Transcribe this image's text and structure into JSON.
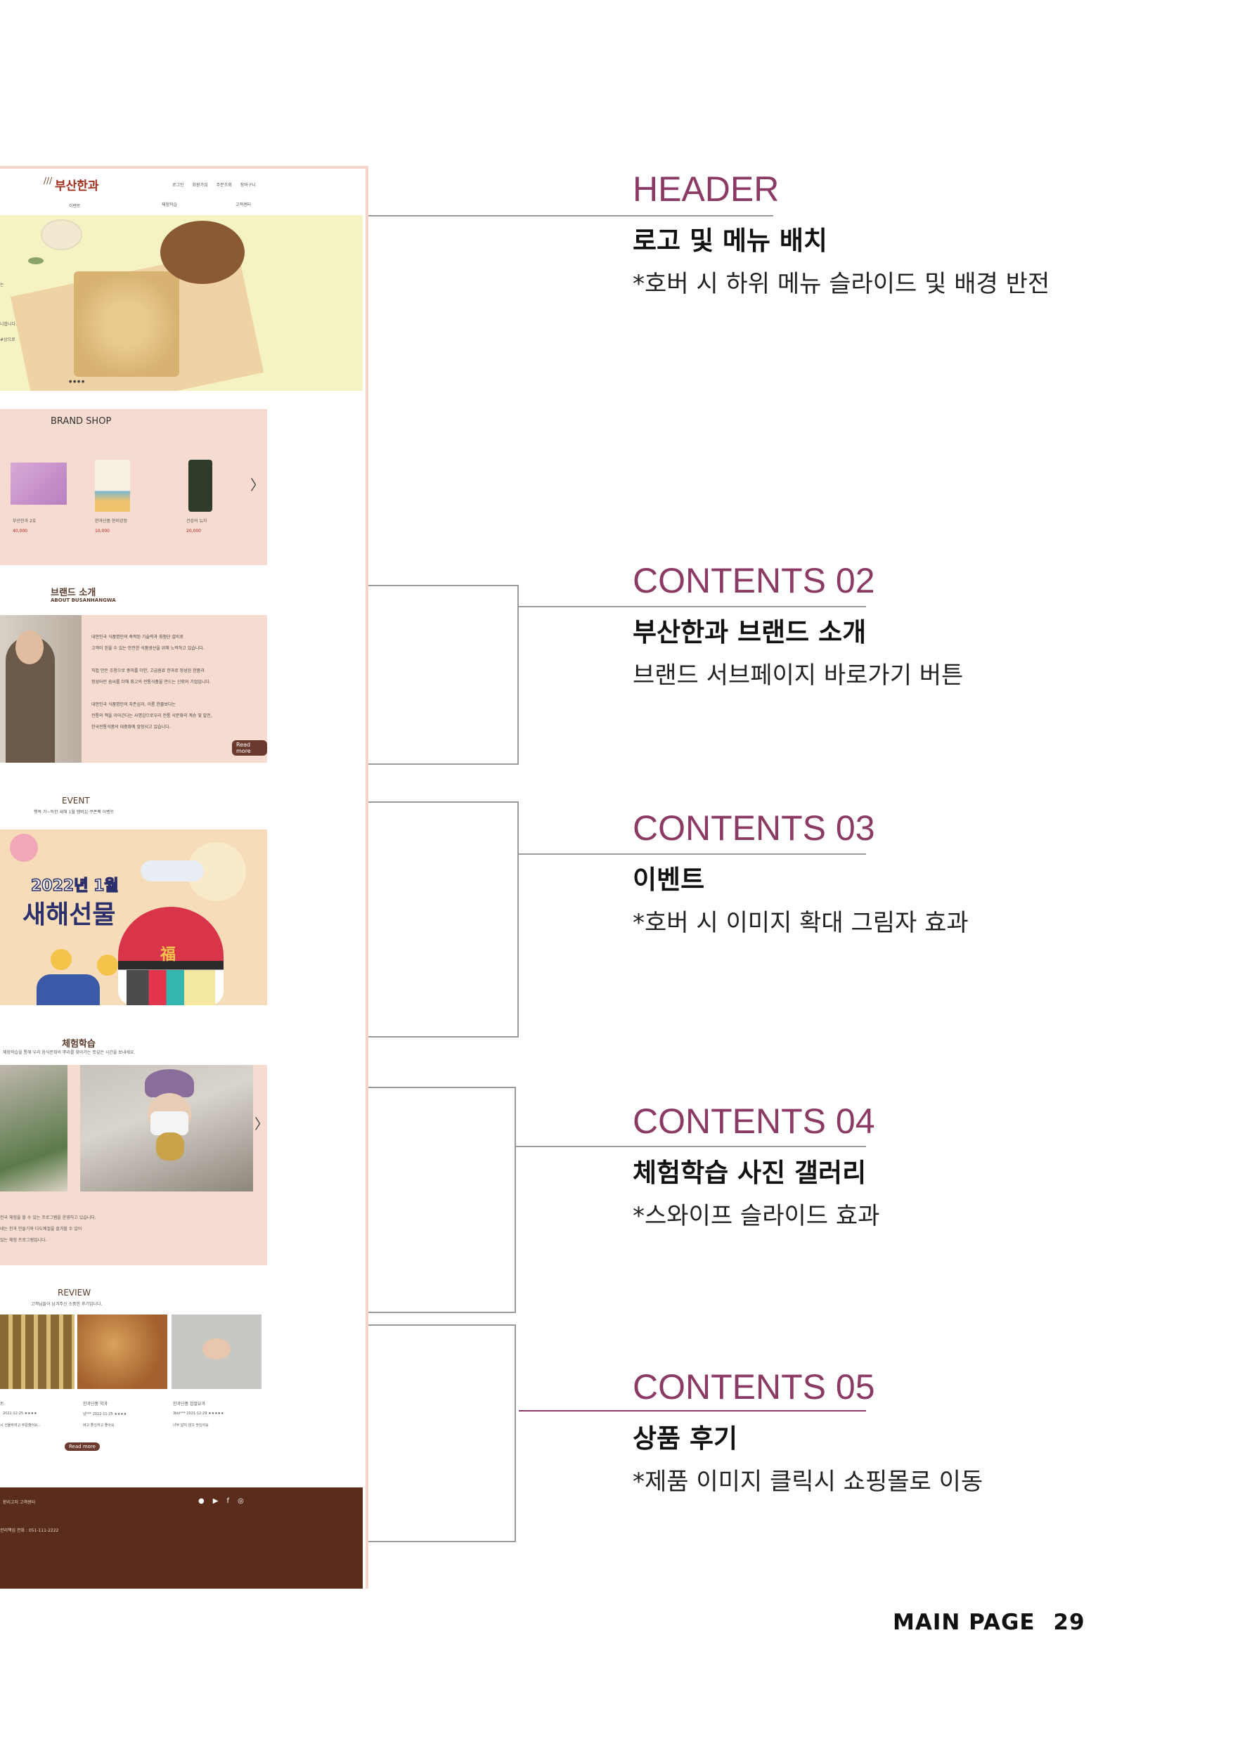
{
  "mockup": {
    "header": {
      "logo": "부산한과",
      "top_links": [
        "로그인",
        "회원가입",
        "주문조회",
        "장바구니"
      ],
      "nav": [
        "이벤트",
        "체험학습",
        "고객센터"
      ]
    },
    "hero": {
      "text_lines": [
        "는",
        "니합니다.",
        "#상으로"
      ],
      "dots": "● ● ● ●"
    },
    "brand_shop": {
      "title": "BRAND SHOP",
      "products": [
        {
          "name": "부산한과 2호",
          "price": "40,000"
        },
        {
          "name": "한과단품 현미강정",
          "price": "10,000"
        },
        {
          "name": "건강의 뉴차",
          "price": "20,000"
        }
      ],
      "arrow": "〉"
    },
    "about": {
      "title": "브랜드 소개",
      "subtitle": "ABOUT BUSANHANGWA",
      "paragraphs": [
        "대한민국 식품명인의 축적된 기술력과 최첨단 설비로",
        "고객이 믿을 수 있는 안전한 식품생산을 위해 노력하고 있습니다.",
        "직접 만든 조청으로 풍미를 더한, 고급원료 한과로 정성된 한품과",
        "정성어린 솜씨를 더해 최고의 전통식품을 만드는 신뢰의 기업입니다.",
        "대한민국 식품명인의 자존심과, 이름 한줄보다는",
        "전통의 맥을 이어간다는 사명감으로우리 전통 식문화의 계승 및 발전,",
        "한국전통식품의 대중화에 앞장서고 있습니다."
      ],
      "read_more": "Read more"
    },
    "event": {
      "title": "EVENT",
      "subtitle": "행복 가~득한 새해 1월 멤버십 쿠폰팩 이벤트",
      "banner_year": "2022년 1월",
      "banner_title": "새해선물",
      "bag_char": "福"
    },
    "experience": {
      "title": "체험학습",
      "subtitle": "체험학습을 통해 우리 음식문화의 뿌리를 찾아가는 뜻깊은 시간을 보내세요.",
      "lines": [
        "전국 체험을 할 수 있는 프로그램을 운영하고 있습니다.",
        "네는 한과 만들기와 다도예절을 즐겨볼 수 있어",
        "있는 체험 프로그램입니다."
      ],
      "arrow": "〉"
    },
    "review": {
      "title": "REVIEW",
      "subtitle": "고객님들이 남겨주신 소중한 후기입니다.",
      "items": [
        {
          "name": "트",
          "meta": "2021-12-25  ★★★★",
          "text": "시 선물하려고 주문했어요.."
        },
        {
          "name": "한과단품 약과",
          "meta": "남***    2022-11-25  ★★★★",
          "text": "바고 쫄깃하고 좋아요"
        },
        {
          "name": "한과단품 찹쌀유과",
          "meta": "3kkl***    2021-12-29  ★★★★★",
          "text": "너무 달지 않고 맛있어요"
        }
      ],
      "read_more": "Read more"
    },
    "footer": {
      "links": "환리고지   고객센터",
      "contact": "관리책임 전화 : 051-111-2222",
      "social": [
        "●",
        "▶",
        "f",
        "◎"
      ]
    }
  },
  "annotations": [
    {
      "title": "HEADER",
      "heading": "로고 및 메뉴 배치",
      "desc": "*호버 시 하위 메뉴 슬라이드 및 배경 반전"
    },
    {
      "title": "CONTENTS 02",
      "heading": "부산한과 브랜드 소개",
      "desc": "브랜드 서브페이지 바로가기 버튼"
    },
    {
      "title": "CONTENTS 03",
      "heading": "이벤트",
      "desc": "*호버 시 이미지 확대 그림자  효과"
    },
    {
      "title": "CONTENTS 04",
      "heading": "체험학습 사진 갤러리",
      "desc": "*스와이프 슬라이드 효과"
    },
    {
      "title": "CONTENTS 05",
      "heading": "상품 후기",
      "desc": "*제품 이미지 클릭시 쇼핑몰로 이동"
    }
  ],
  "page_footer": {
    "label": "MAIN PAGE",
    "number": "29"
  },
  "colors": {
    "accent": "#8b3a63",
    "mockup_pink": "#f6dbd1",
    "footer_brown": "#5a2c1c",
    "hero_yellow": "#f5f2c4"
  }
}
